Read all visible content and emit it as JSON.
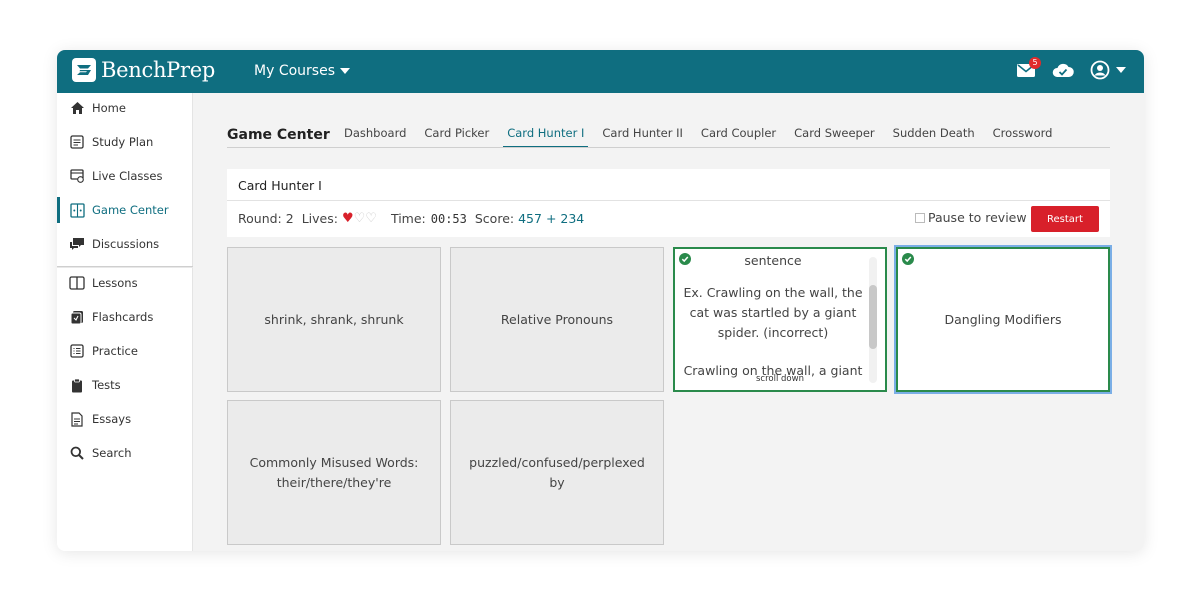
{
  "brand": {
    "name": "BenchPrep"
  },
  "topbar": {
    "courses_label": "My Courses",
    "notification_count": "5"
  },
  "sidebar": {
    "items": [
      {
        "label": "Home",
        "icon": "home-icon"
      },
      {
        "label": "Study Plan",
        "icon": "study-plan-icon"
      },
      {
        "label": "Live Classes",
        "icon": "live-classes-icon"
      },
      {
        "label": "Game Center",
        "icon": "game-center-icon",
        "active": true
      },
      {
        "label": "Discussions",
        "icon": "discussions-icon"
      },
      {
        "label": "Lessons",
        "icon": "lessons-icon"
      },
      {
        "label": "Flashcards",
        "icon": "flashcards-icon"
      },
      {
        "label": "Practice",
        "icon": "practice-icon"
      },
      {
        "label": "Tests",
        "icon": "tests-icon"
      },
      {
        "label": "Essays",
        "icon": "essays-icon"
      },
      {
        "label": "Search",
        "icon": "search-icon"
      }
    ]
  },
  "main": {
    "title": "Game Center",
    "tabs": [
      {
        "label": "Dashboard"
      },
      {
        "label": "Card Picker"
      },
      {
        "label": "Card Hunter I",
        "active": true
      },
      {
        "label": "Card Hunter II"
      },
      {
        "label": "Card Coupler"
      },
      {
        "label": "Card Sweeper"
      },
      {
        "label": "Sudden Death"
      },
      {
        "label": "Crossword"
      }
    ]
  },
  "game": {
    "name": "Card Hunter I",
    "round_label": "Round:",
    "round_value": "2",
    "lives_label": "Lives:",
    "lives_total": 3,
    "lives_remaining": 1,
    "time_label": "Time:",
    "time_value": "00:53",
    "score_label": "Score:",
    "score_value": "457 + 234",
    "pause_label": "Pause to review",
    "restart_label": "Restart"
  },
  "cards": [
    {
      "text": "shrink, shrank, shrunk",
      "state": "default"
    },
    {
      "text": "Relative Pronouns",
      "state": "default"
    },
    {
      "text_lines": [
        "sentence",
        "Ex. Crawling on the wall, the cat was startled by a giant spider. (incorrect)",
        "Crawling on the wall, a giant"
      ],
      "state": "matched",
      "scroll_hint": "scroll down"
    },
    {
      "text": "Dangling Modifiers",
      "state": "selected"
    },
    {
      "text": "Commonly Misused Words: their/there/they're",
      "state": "default"
    },
    {
      "text": "puzzled/confused/perplexed by",
      "state": "default"
    }
  ],
  "colors": {
    "brand": "#0f6e80",
    "matched": "#2a8a4b",
    "restart": "#d8202a",
    "heart": "#d8202a"
  }
}
